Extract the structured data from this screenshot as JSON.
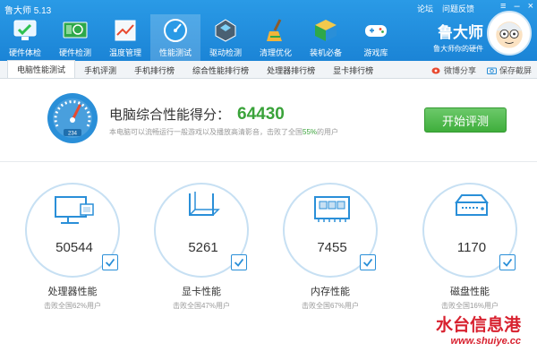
{
  "app": {
    "title": "鲁大师 5.13"
  },
  "top_links": [
    "论坛",
    "问题反馈"
  ],
  "window_controls": [
    "≡",
    "–",
    "×"
  ],
  "nav": [
    {
      "label": "硬件体检",
      "icon": "hardware-check-icon"
    },
    {
      "label": "硬件检测",
      "icon": "hardware-detect-icon"
    },
    {
      "label": "温度管理",
      "icon": "temperature-icon"
    },
    {
      "label": "性能测试",
      "icon": "performance-icon"
    },
    {
      "label": "驱动检测",
      "icon": "driver-icon"
    },
    {
      "label": "清理优化",
      "icon": "broom-icon"
    },
    {
      "label": "装机必备",
      "icon": "install-icon"
    },
    {
      "label": "游戏库",
      "icon": "gamepad-icon"
    }
  ],
  "brand": {
    "name": "鲁大师",
    "slogan": "鲁大师你的硬件"
  },
  "tabs": [
    "电脑性能测试",
    "手机评测",
    "手机排行榜",
    "综合性能排行榜",
    "处理器排行榜",
    "显卡排行榜"
  ],
  "tab_actions": {
    "share": "微博分享",
    "save": "保存截屏"
  },
  "gauge": {
    "readout": "234"
  },
  "score": {
    "label": "电脑综合性能得分：",
    "value": "64430",
    "desc_before": "本电脑可以流畅运行一般游戏以及播放高清影音，击败了全国",
    "desc_pct": "55%",
    "desc_after": "的用户"
  },
  "start_button": "开始评测",
  "cards": [
    {
      "score": "50544",
      "title": "处理器性能",
      "sub": "击败全国62%用户",
      "icon": "cpu-icon"
    },
    {
      "score": "5261",
      "title": "显卡性能",
      "sub": "击败全国47%用户",
      "icon": "gpu-icon"
    },
    {
      "score": "7455",
      "title": "内存性能",
      "sub": "击败全国67%用户",
      "icon": "memory-icon"
    },
    {
      "score": "1170",
      "title": "磁盘性能",
      "sub": "击败全国16%用户",
      "icon": "disk-icon"
    }
  ],
  "watermark": {
    "text": "水台信息港",
    "url": "www.shuiye.cc"
  },
  "colors": {
    "header": "#1b84d6",
    "accent_green": "#3aa33a",
    "card_border": "#c7e0f3",
    "check": "#2a8fd8"
  }
}
